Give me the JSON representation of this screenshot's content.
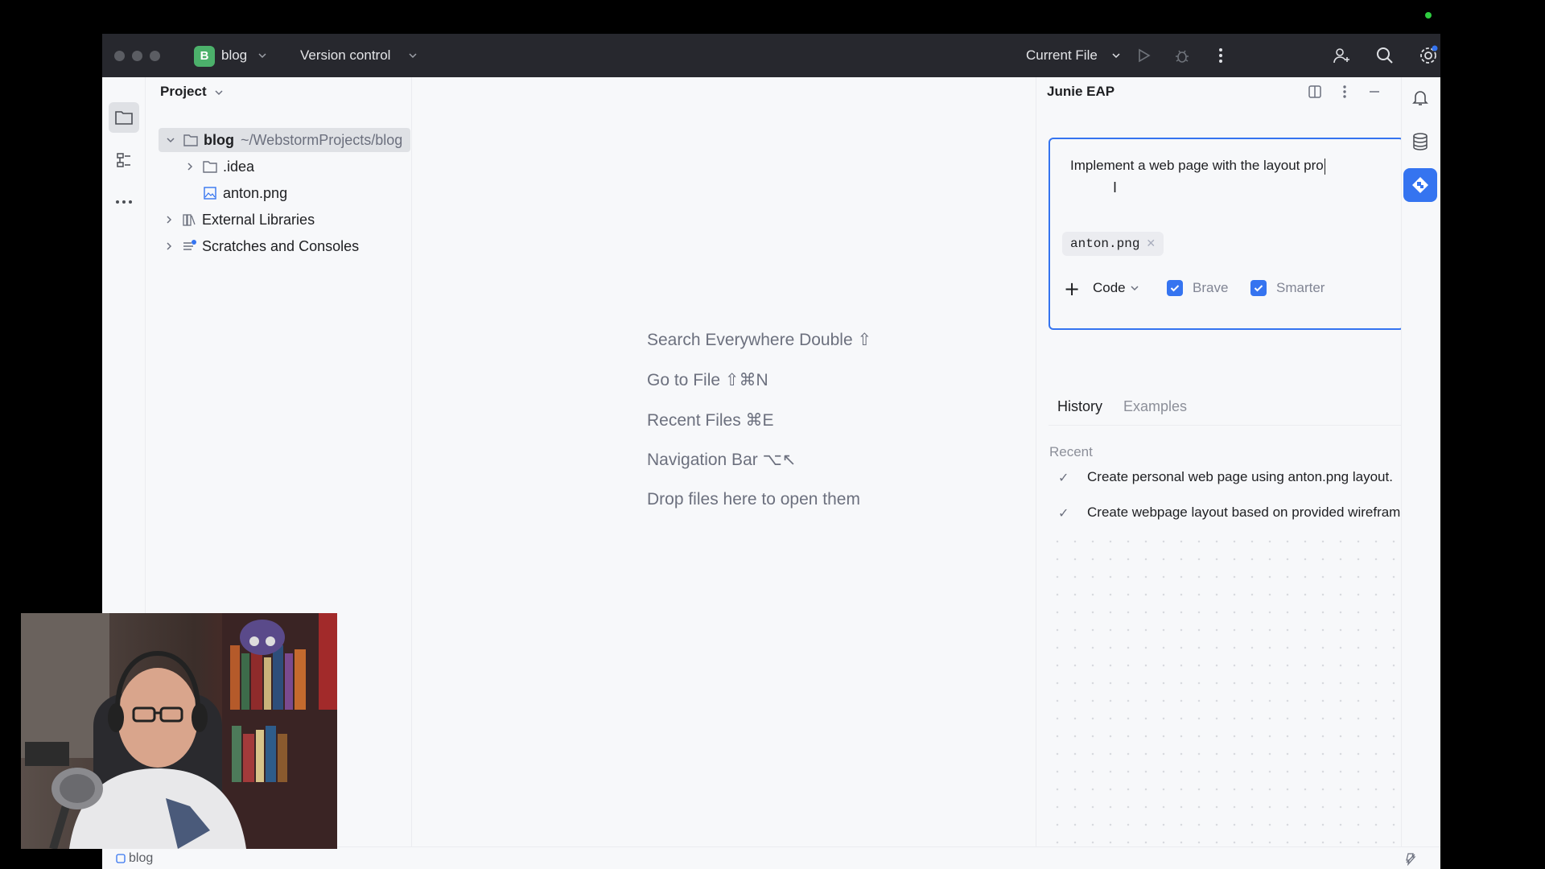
{
  "titlebar": {
    "project_initial": "B",
    "project_name": "blog",
    "vcs_label": "Version control",
    "run_config": "Current File"
  },
  "project_panel": {
    "title": "Project",
    "tree": [
      {
        "label": "blog",
        "path": "~/WebstormProjects/blog"
      },
      {
        "label": ".idea"
      },
      {
        "label": "anton.png"
      },
      {
        "label": "External Libraries"
      },
      {
        "label": "Scratches and Consoles"
      }
    ]
  },
  "editor": {
    "hints": [
      "Search Everywhere Double ⇧",
      "Go to File ⇧⌘N",
      "Recent Files ⌘E",
      "Navigation Bar ⌥↖",
      "Drop files here to open them"
    ]
  },
  "junie": {
    "title": "Junie EAP",
    "prompt_value": "Implement a web page with the layout pro",
    "attachment": "anton.png",
    "mode": "Code",
    "options": [
      {
        "label": "Brave",
        "checked": true
      },
      {
        "label": "Smarter",
        "checked": true
      }
    ],
    "send_label": "→",
    "tabs": [
      {
        "label": "History",
        "active": true
      },
      {
        "label": "Examples",
        "active": false
      }
    ],
    "recent_label": "Recent",
    "history": [
      "Create personal web page using anton.png layout.",
      "Create webpage layout based on provided wireframe im..."
    ]
  },
  "statusbar": {
    "breadcrumb": "blog"
  },
  "colors": {
    "accent": "#3574f0",
    "titlebar_bg": "#27282e",
    "panel_bg": "#f7f8fa",
    "project_badge": "#4cb16b"
  }
}
